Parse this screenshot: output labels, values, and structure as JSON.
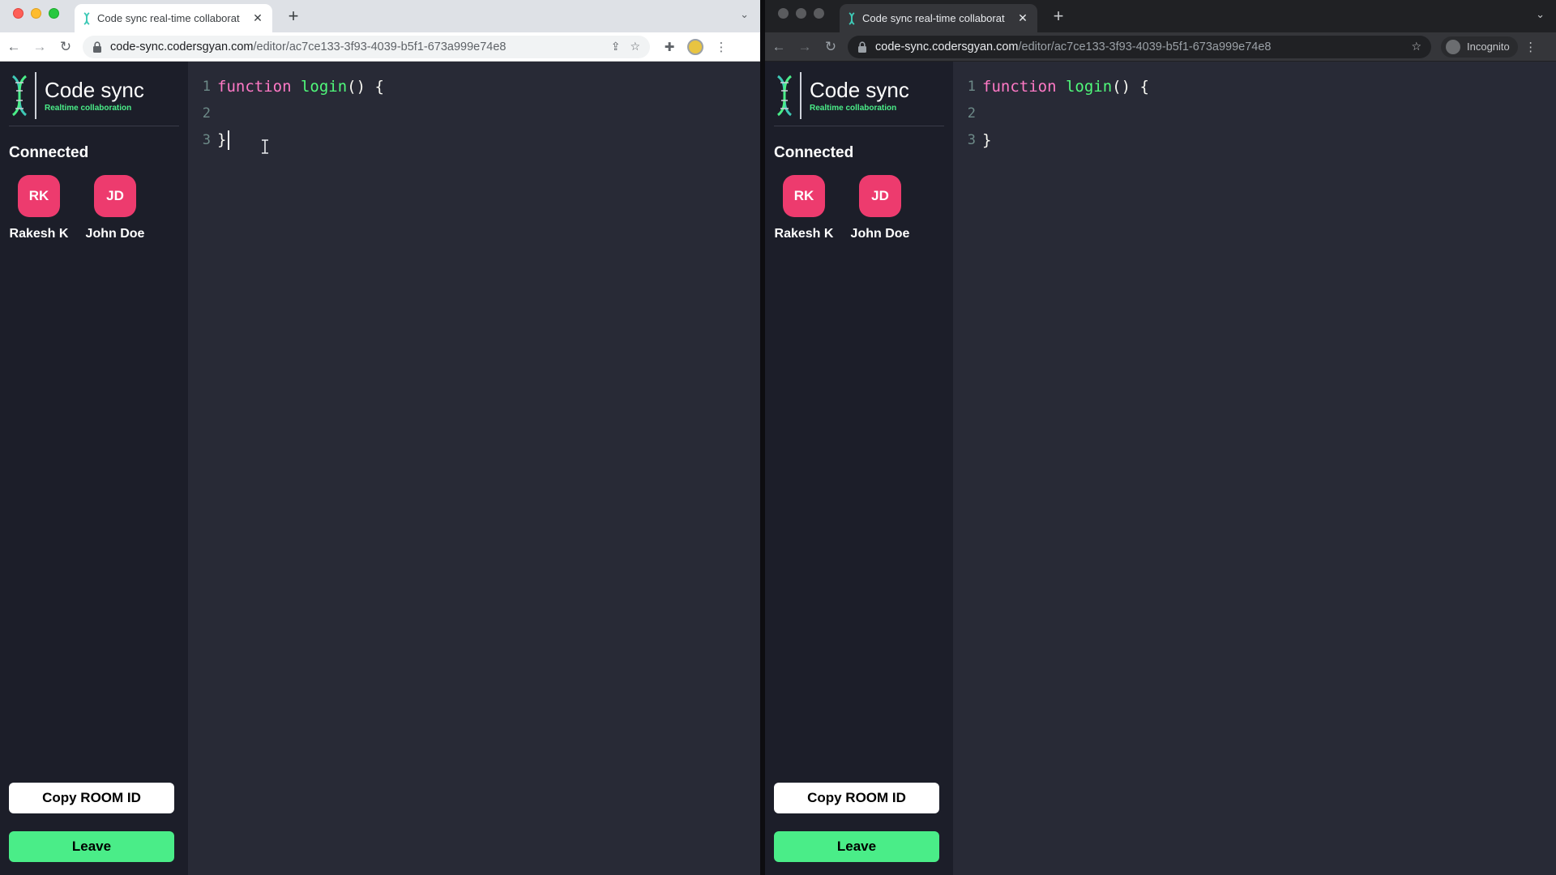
{
  "colors": {
    "sidebar_bg": "#1c1e29",
    "editor_bg": "#282a36",
    "accent_green": "#4aed88",
    "avatar_pink": "#ed3b6e",
    "keyword": "#ff79c6",
    "function_name": "#50fa7b"
  },
  "windows": [
    {
      "id": "left",
      "theme": "light",
      "tab": {
        "title": "Code sync real-time collaborat",
        "close_icon": "close-icon"
      },
      "address": {
        "host": "code-sync.codersgyan.com",
        "path": "/editor/ac7ce133-3f93-4039-b5f1-673a999e74e8"
      },
      "toolbar_icons": [
        "share-icon",
        "star-icon",
        "puzzle-icon",
        "extension-icon",
        "kebab-icon"
      ],
      "app": {
        "logo_title": "Code sync",
        "logo_subtitle": "Realtime collaboration",
        "connected_label": "Connected",
        "clients": [
          {
            "initials": "RK",
            "name": "Rakesh K"
          },
          {
            "initials": "JD",
            "name": "John Doe"
          }
        ],
        "copy_button": "Copy ROOM ID",
        "leave_button": "Leave",
        "code": {
          "line_numbers": [
            "1",
            "2",
            "3"
          ],
          "keyword": "function",
          "fn_name": "login",
          "line1_rest": "() {",
          "line3": "}"
        }
      }
    },
    {
      "id": "right",
      "theme": "dark",
      "tab": {
        "title": "Code sync real-time collaborat",
        "close_icon": "close-icon"
      },
      "address": {
        "host": "code-sync.codersgyan.com",
        "path": "/editor/ac7ce133-3f93-4039-b5f1-673a999e74e8"
      },
      "incognito_label": "Incognito",
      "toolbar_icons": [
        "star-icon",
        "incognito-icon",
        "kebab-icon"
      ],
      "app": {
        "logo_title": "Code sync",
        "logo_subtitle": "Realtime collaboration",
        "connected_label": "Connected",
        "clients": [
          {
            "initials": "RK",
            "name": "Rakesh K"
          },
          {
            "initials": "JD",
            "name": "John Doe"
          }
        ],
        "copy_button": "Copy ROOM ID",
        "leave_button": "Leave",
        "code": {
          "line_numbers": [
            "1",
            "2",
            "3"
          ],
          "keyword": "function",
          "fn_name": "login",
          "line1_rest": "() {",
          "line3": "}"
        }
      }
    }
  ]
}
